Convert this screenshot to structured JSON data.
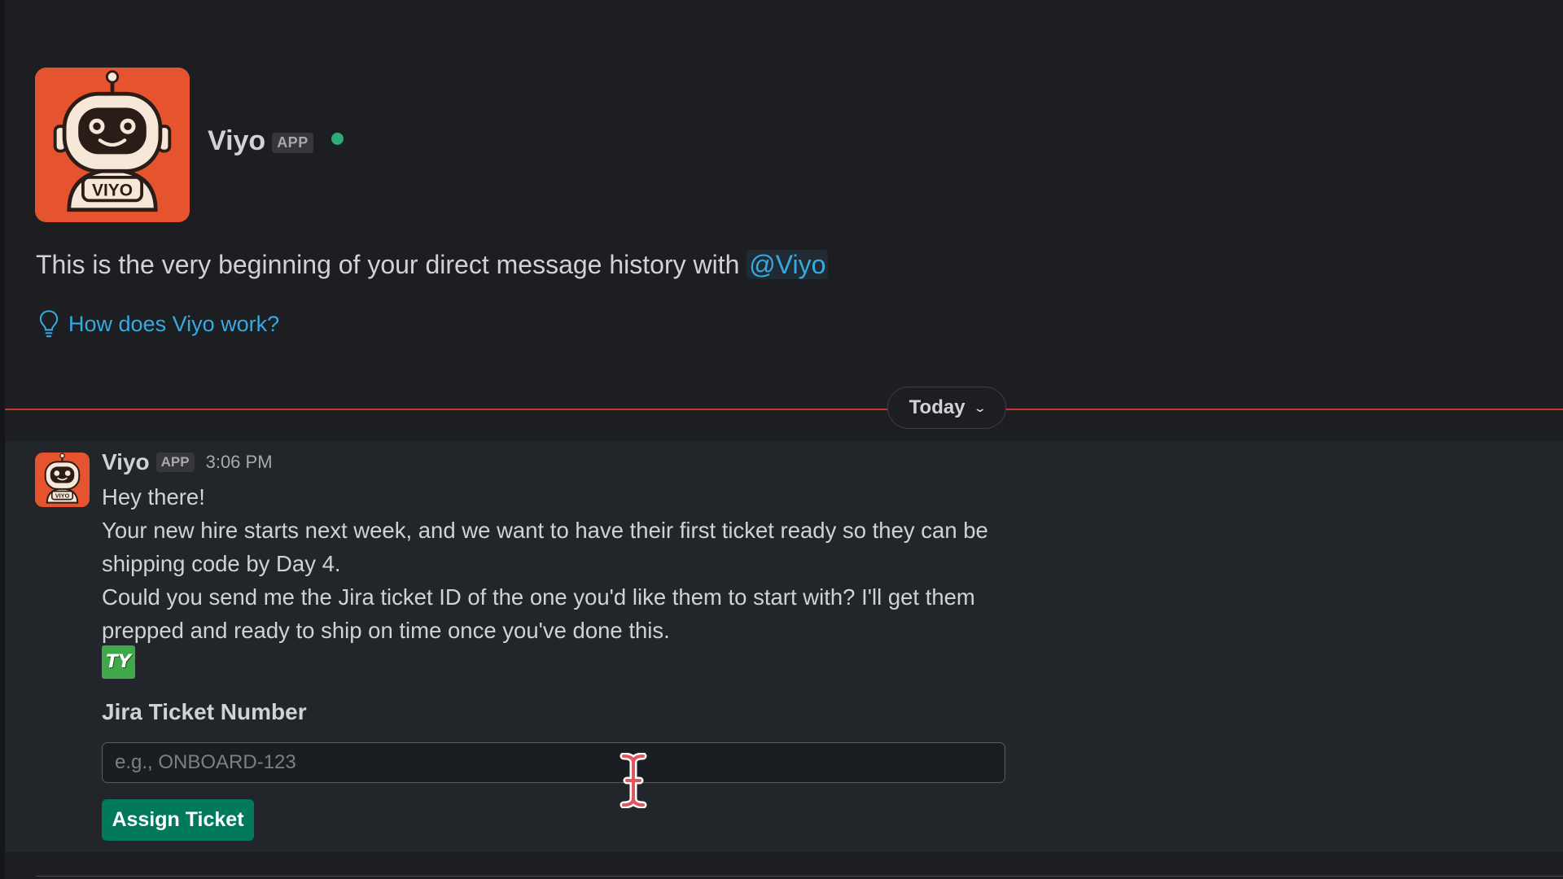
{
  "bot": {
    "name": "Viyo",
    "badge": "APP",
    "status": "online",
    "logo_text": "VIYO"
  },
  "intro": {
    "text": "This is the very beginning of your direct message history with ",
    "mention": "@Viyo",
    "help_link": "How does Viyo work?"
  },
  "divider": {
    "label": "Today"
  },
  "message": {
    "sender": "Viyo",
    "badge": "APP",
    "time": "3:06 PM",
    "lines": [
      "Hey there!",
      "Your new hire starts next week, and we want to have their first ticket ready so they can be shipping code by Day 4.",
      "Could you send me the Jira ticket ID of the one you'd like them to start with? I'll get them prepped and ready to ship on time once you've done this."
    ],
    "emoji": "TY"
  },
  "form": {
    "label": "Jira Ticket Number",
    "placeholder": "e.g., ONBOARD-123",
    "value": "",
    "submit_label": "Assign Ticket"
  },
  "colors": {
    "accent_link": "#36a9e1",
    "presence": "#2bac76",
    "divider": "#c3382b",
    "button": "#007a5a",
    "avatar_bg": "#e5532f"
  },
  "icons": {
    "help": "lightbulb-icon",
    "divider_toggle": "chevron-down-icon",
    "cursor": "text-cursor-icon"
  }
}
